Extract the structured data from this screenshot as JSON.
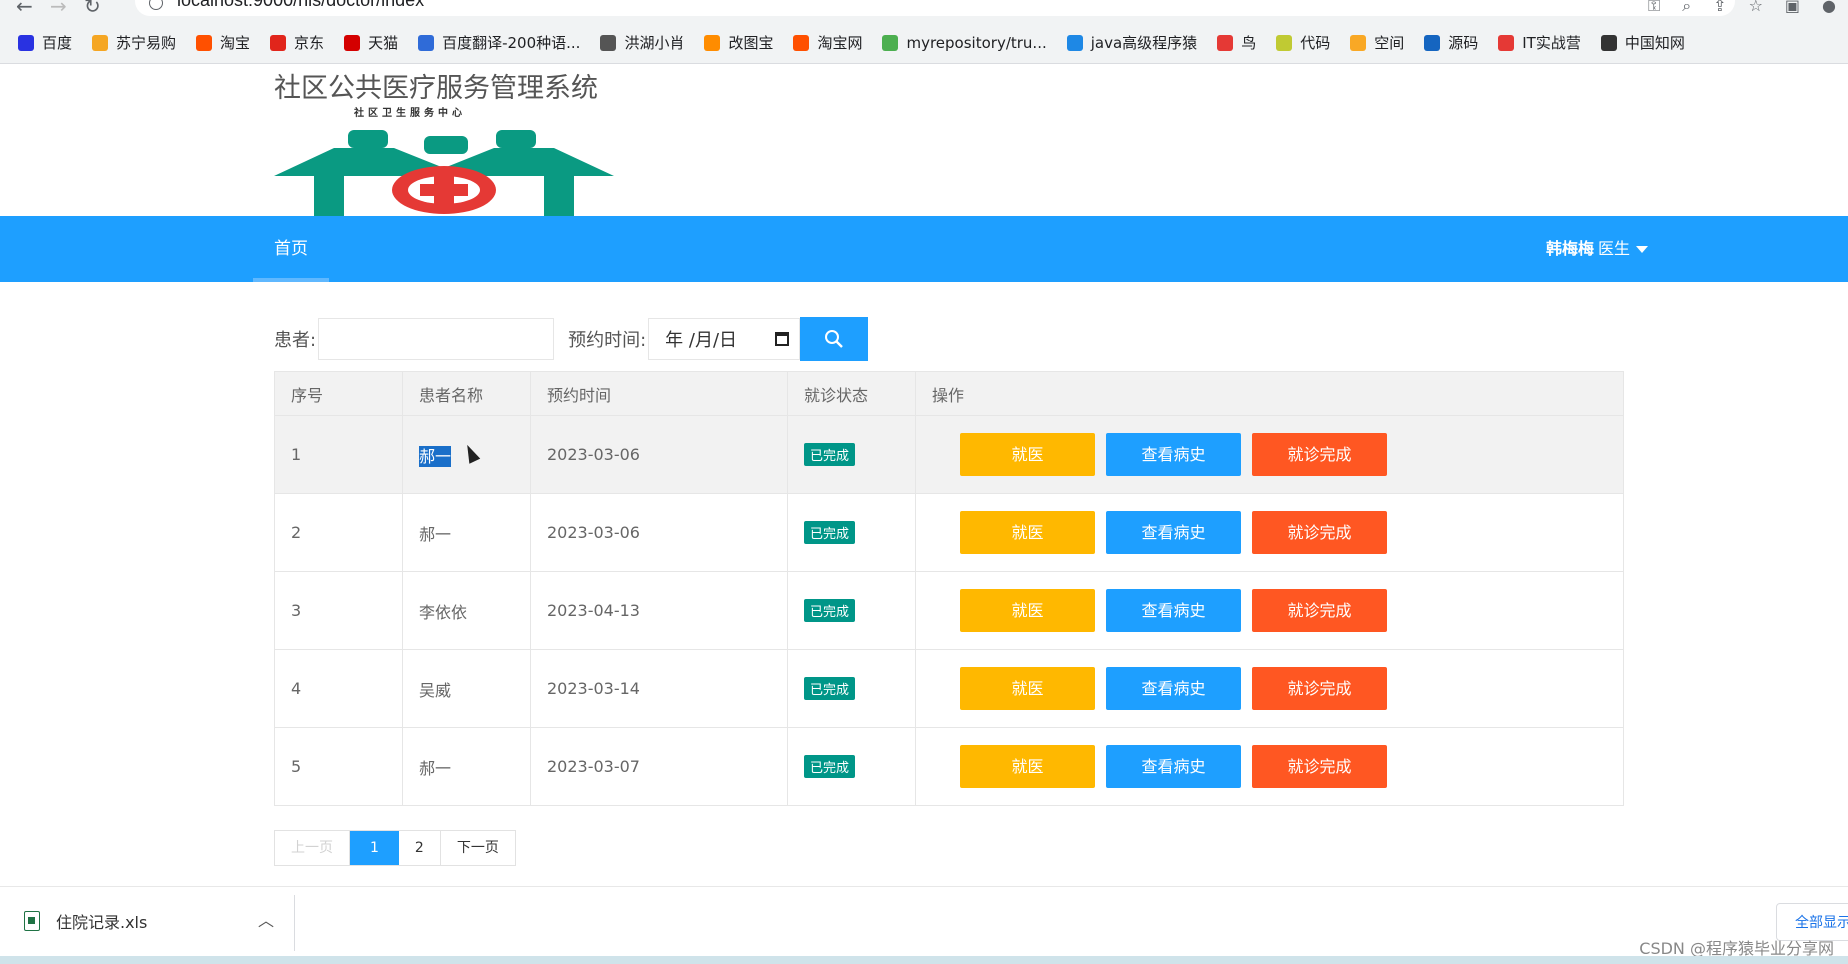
{
  "browser": {
    "url": "localhost:9000/his/doctor/index",
    "bookmarks": [
      {
        "label": "百度",
        "color": "#2932e1"
      },
      {
        "label": "苏宁易购",
        "color": "#f5a623"
      },
      {
        "label": "淘宝",
        "color": "#ff5000"
      },
      {
        "label": "京东",
        "color": "#e1251b"
      },
      {
        "label": "天猫",
        "color": "#d40000"
      },
      {
        "label": "百度翻译-200种语...",
        "color": "#2f6bd8"
      },
      {
        "label": "洪湖小肖",
        "color": "#555555"
      },
      {
        "label": "改图宝",
        "color": "#ff8c00"
      },
      {
        "label": "淘宝网",
        "color": "#ff5000"
      },
      {
        "label": "myrepository/tru...",
        "color": "#4caf50"
      },
      {
        "label": "java高级程序猿",
        "color": "#1e88e5"
      },
      {
        "label": "鸟",
        "color": "#e53935"
      },
      {
        "label": "代码",
        "color": "#c0ca33"
      },
      {
        "label": "空间",
        "color": "#f9a825"
      },
      {
        "label": "源码",
        "color": "#1565c0"
      },
      {
        "label": "IT实战营",
        "color": "#e53935"
      },
      {
        "label": "中国知网",
        "color": "#333333"
      }
    ]
  },
  "header": {
    "title": "社区公共医疗服务管理系统",
    "logo_text": "社区卫生服务中心"
  },
  "nav": {
    "home": "首页",
    "user_name": "韩梅梅",
    "user_role": "医生"
  },
  "search": {
    "patient_label": "患者:",
    "patient_value": "",
    "time_label": "预约时间:",
    "date_placeholder": "年 /月/日"
  },
  "table": {
    "headers": [
      "序号",
      "患者名称",
      "预约时间",
      "就诊状态",
      "操作"
    ],
    "rows": [
      {
        "no": "1",
        "name": "郝一",
        "time": "2023-03-06",
        "status": "已完成"
      },
      {
        "no": "2",
        "name": "郝一",
        "time": "2023-03-06",
        "status": "已完成"
      },
      {
        "no": "3",
        "name": "李依依",
        "time": "2023-04-13",
        "status": "已完成"
      },
      {
        "no": "4",
        "name": "吴威",
        "time": "2023-03-14",
        "status": "已完成"
      },
      {
        "no": "5",
        "name": "郝一",
        "time": "2023-03-07",
        "status": "已完成"
      }
    ],
    "actions": {
      "visit": "就医",
      "history": "查看病史",
      "complete": "就诊完成"
    }
  },
  "pagination": {
    "prev": "上一页",
    "pages": [
      "1",
      "2"
    ],
    "current": "1",
    "next": "下一页"
  },
  "download": {
    "file": "住院记录.xls",
    "show_all": "全部显示"
  },
  "watermark": "CSDN @程序猿毕业分享网",
  "colors": {
    "primary": "#1e9fff",
    "warm": "#ffb800",
    "danger": "#ff5722",
    "success": "#009688"
  }
}
